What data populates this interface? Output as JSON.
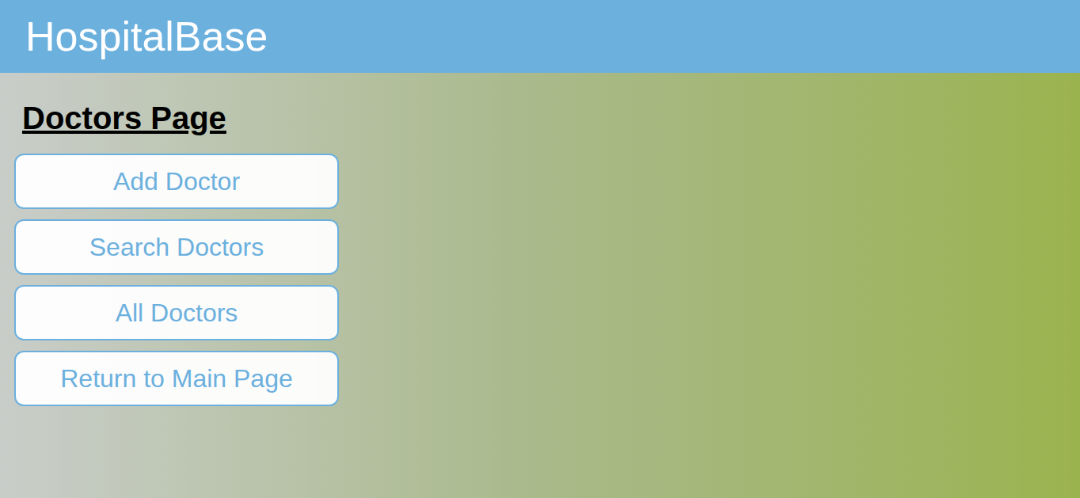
{
  "header": {
    "title": "HospitalBase"
  },
  "page": {
    "heading": "Doctors Page"
  },
  "buttons": [
    {
      "label": "Add Doctor"
    },
    {
      "label": "Search Doctors"
    },
    {
      "label": "All Doctors"
    },
    {
      "label": "Return to Main Page"
    }
  ]
}
